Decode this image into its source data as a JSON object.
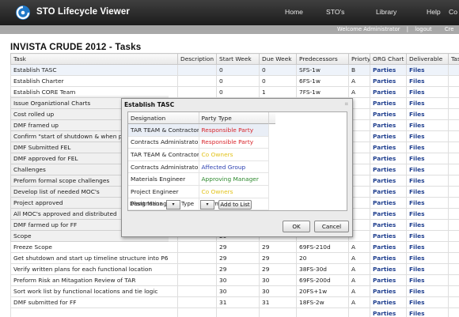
{
  "header": {
    "app_title": "STO Lifecycle Viewer",
    "nav": [
      "Home",
      "STO's",
      "Library",
      "Help",
      "Co"
    ],
    "subbar": {
      "welcome": "Welcome Administrator",
      "sep": "|",
      "logout": "logout",
      "extra": "Cre"
    }
  },
  "page": {
    "title": "INVISTA CRUDE 2012 - Tasks"
  },
  "grid": {
    "columns": [
      "Task",
      "Description",
      "Start Week",
      "Due Week",
      "Predecessors",
      "Priorty",
      "ORG Chart",
      "Deliverable",
      "Task O"
    ],
    "rows": [
      [
        "Establish TASC",
        "",
        "0",
        "0",
        "SFS-1w",
        "B",
        "Parties",
        "Files",
        ""
      ],
      [
        "Establish Charter",
        "",
        "0",
        "0",
        "6FS-1w",
        "A",
        "Parties",
        "Files",
        ""
      ],
      [
        "Establish CORE Team",
        "",
        "0",
        "1",
        "7FS-1w",
        "A",
        "Parties",
        "Files",
        ""
      ],
      [
        "Issue Organiztional Charts",
        "",
        "",
        "",
        "",
        "",
        "Parties",
        "Files",
        ""
      ],
      [
        "Cost rolled up",
        "",
        "",
        "",
        "",
        "",
        "Parties",
        "Files",
        ""
      ],
      [
        "DMF framed up",
        "",
        "",
        "",
        "",
        "",
        "Parties",
        "Files",
        ""
      ],
      [
        "Confirm \"start of shutdown & when plant",
        "",
        "",
        "",
        "",
        "",
        "Parties",
        "Files",
        ""
      ],
      [
        "DMF Submitted FEL",
        "",
        "",
        "",
        "",
        "",
        "Parties",
        "Files",
        ""
      ],
      [
        "DMF approved for FEL",
        "",
        "",
        "",
        "",
        "",
        "Parties",
        "Files",
        ""
      ],
      [
        "Challenges",
        "",
        "",
        "",
        "",
        "",
        "Parties",
        "Files",
        ""
      ],
      [
        "Preform formal scope challenges",
        "",
        "",
        "",
        "",
        "",
        "Parties",
        "Files",
        ""
      ],
      [
        "Develop list of needed MOC's",
        "",
        "",
        "",
        "",
        "",
        "Parties",
        "Files",
        ""
      ],
      [
        "Project approved",
        "",
        "",
        "",
        "",
        "",
        "Parties",
        "Files",
        ""
      ],
      [
        "All MOC's approved and distributed",
        "",
        "",
        "",
        "",
        "",
        "Parties",
        "Files",
        ""
      ],
      [
        "DMF farmed up for FF",
        "",
        "",
        "",
        "",
        "",
        "Parties",
        "Files",
        ""
      ],
      [
        "Scope",
        "",
        "29",
        "",
        "",
        "",
        "Parties",
        "Files",
        ""
      ],
      [
        "Freeze Scope",
        "",
        "29",
        "29",
        "69FS-210d",
        "A",
        "Parties",
        "Files",
        ""
      ],
      [
        "Get shutdown and start up timeline structure into P6",
        "",
        "29",
        "29",
        "20",
        "A",
        "Parties",
        "Files",
        ""
      ],
      [
        "Verify written plans for each functional location",
        "",
        "29",
        "29",
        "38FS-30d",
        "A",
        "Parties",
        "Files",
        ""
      ],
      [
        "Preform Risk an Mitagation Review of TAR",
        "",
        "30",
        "30",
        "69FS-200d",
        "A",
        "Parties",
        "Files",
        ""
      ],
      [
        "Sort work list by functional locations and tie logic",
        "",
        "30",
        "30",
        "20FS+1w",
        "A",
        "Parties",
        "Files",
        ""
      ],
      [
        "DMF submitted for FF",
        "",
        "31",
        "31",
        "18FS-2w",
        "A",
        "Parties",
        "Files",
        ""
      ],
      [
        "",
        "",
        "",
        "",
        "",
        "",
        "Parties",
        "Files",
        ""
      ]
    ]
  },
  "dialog": {
    "title": "Establish TASC",
    "close": "⌗",
    "columns": [
      "Designation",
      "Party Type"
    ],
    "rows": [
      {
        "designation": "TAR TEAM & Contractors",
        "party_type": "Responsible Party",
        "color": "#d8262c"
      },
      {
        "designation": "Contracts Administrator",
        "party_type": "Responsible Party",
        "color": "#d8262c"
      },
      {
        "designation": "TAR TEAM & Contractors",
        "party_type": "Co Owners",
        "color": "#e2c21a"
      },
      {
        "designation": "Contracts Administrator",
        "party_type": "Affected Group",
        "color": "#2b3fb0"
      },
      {
        "designation": "Materials Engineer",
        "party_type": "Approving Manager",
        "color": "#2f8a2f"
      },
      {
        "designation": "Project Engineer",
        "party_type": "Co Owners",
        "color": "#e2c21a"
      },
      {
        "designation": "Plant Manager",
        "party_type": "Informed",
        "color": "#222222"
      }
    ],
    "filter": {
      "designation_label": "Designation",
      "type_label": "Type",
      "dropdown_glyph": "▾",
      "add_button": "Add to List"
    },
    "ok_button": "OK",
    "cancel_button": "Cancel"
  },
  "colors": {
    "link": "#1f3f8f",
    "header_bg": "#2a2a2a",
    "logo_blue": "#1f78c8"
  }
}
